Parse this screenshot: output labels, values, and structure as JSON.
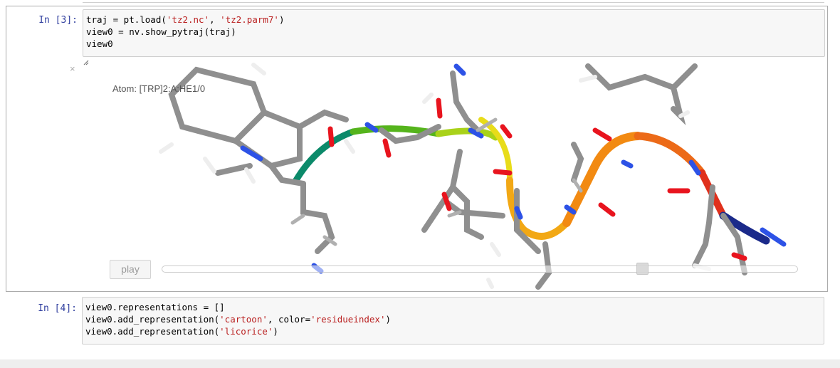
{
  "cells": [
    {
      "prompt": "In [3]:",
      "lines": [
        [
          "traj = pt.load(",
          "'tz2.nc'",
          ", ",
          "'tz2.parm7'",
          ")"
        ],
        [
          "view0 = nv.show_pytraj(traj)",
          "",
          "",
          "",
          ""
        ],
        [
          "view0",
          "",
          "",
          "",
          ""
        ]
      ]
    },
    {
      "prompt": "In [4]:",
      "lines": [
        [
          "view0.representations = []",
          "",
          "",
          "",
          ""
        ],
        [
          "view0.add_representation(",
          "'cartoon'",
          ", color=",
          "'residueindex'",
          ")"
        ],
        [
          "view0.add_representation(",
          "'licorice'",
          ")",
          "",
          ""
        ]
      ]
    }
  ],
  "widget": {
    "close_symbol": "×",
    "atom_label": "Atom: [TRP]2:A:HE1/0",
    "play_label": "play",
    "frame_fraction": 0.76
  },
  "colors": {
    "prompt": "#303f9f",
    "string": "#ba2121",
    "carbon": "#8c8c8c",
    "oxygen": "#e8141e",
    "nitrogen": "#2d52e6",
    "hydrogen": "#f2f2f2"
  }
}
